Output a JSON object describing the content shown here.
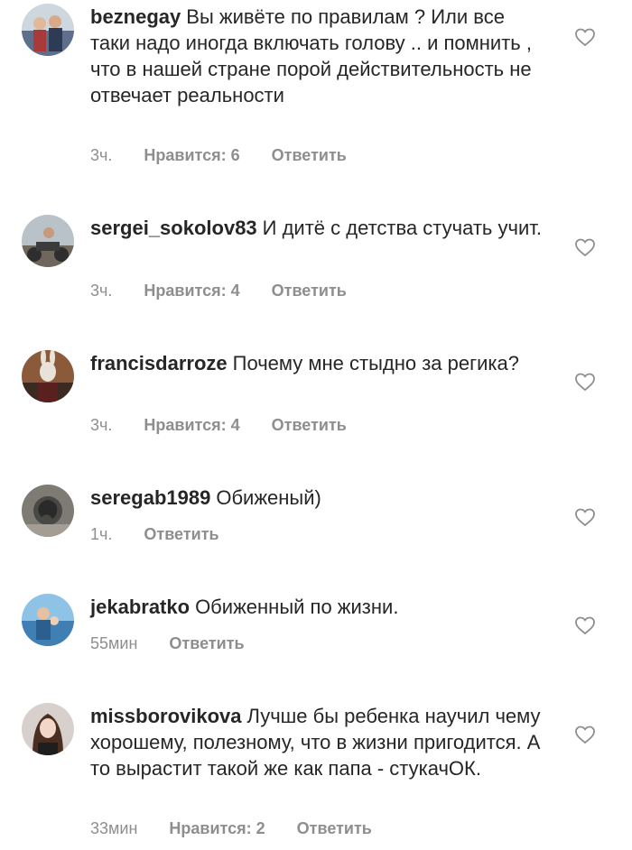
{
  "comments": [
    {
      "username": "beznegay",
      "text": "Вы живёте по правилам ? Или все таки надо иногда включать голову .. и помнить , что в нашей стране порой действительность не отвечает реальности",
      "time": "3ч.",
      "likes": "Нравится: 6",
      "reply": "Ответить"
    },
    {
      "username": "sergei_sokolov83",
      "text": "И дитё с детства стучать учит.",
      "time": "3ч.",
      "likes": "Нравится: 4",
      "reply": "Ответить"
    },
    {
      "username": "francisdarroze",
      "text": "Почему мне стыдно за регика?",
      "time": "3ч.",
      "likes": "Нравится: 4",
      "reply": "Ответить"
    },
    {
      "username": "seregab1989",
      "text": "Обиженый)",
      "time": "1ч.",
      "reply": "Ответить"
    },
    {
      "username": "jekabratko",
      "text": "Обиженный по жизни.",
      "time": "55мин",
      "reply": "Ответить"
    },
    {
      "username": "missborovikova",
      "text": "Лучше бы ребенка научил чему хорошему, полезному, что в жизни пригодится. А то вырастит такой же как папа - стукачОК.",
      "time": "33мин",
      "likes": "Нравится: 2",
      "reply": "Ответить"
    }
  ],
  "colors": {
    "text": "#262626",
    "meta": "#8e8e8e",
    "background": "#ffffff"
  },
  "icons": {
    "like": "heart-outline-icon"
  }
}
